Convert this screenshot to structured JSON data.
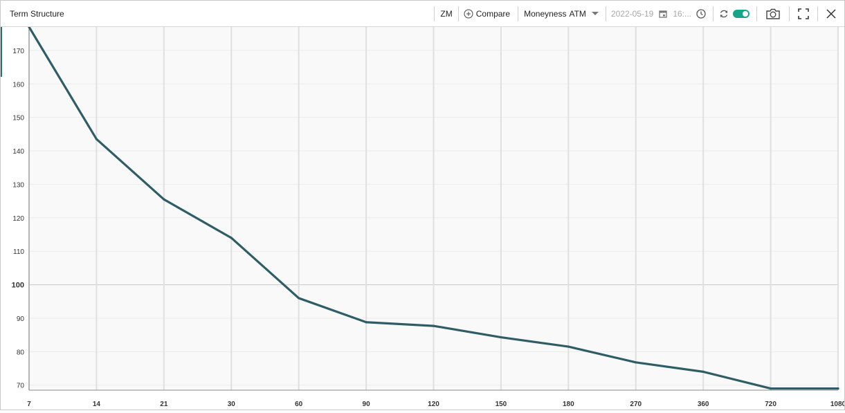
{
  "header": {
    "title": "Term Structure",
    "ticker": "ZM",
    "compare_label": "Compare",
    "moneyness_label": "Moneyness",
    "moneyness_value": "ATM",
    "date": "2022-05-19",
    "time": "16:..."
  },
  "colors": {
    "line": "#2f5d66",
    "toggle": "#17a589",
    "plot_bg": "#f9f9f9"
  },
  "chart_data": {
    "type": "line",
    "categories": [
      "7",
      "14",
      "21",
      "30",
      "60",
      "90",
      "120",
      "150",
      "180",
      "270",
      "360",
      "720",
      "1080"
    ],
    "values": [
      177.0,
      143.5,
      125.5,
      114.0,
      96.0,
      88.8,
      87.7,
      84.3,
      81.5,
      76.8,
      74.0,
      69.0,
      69.0
    ],
    "yticks": [
      70,
      80,
      90,
      100,
      110,
      120,
      130,
      140,
      150,
      160,
      170
    ],
    "ylim": [
      68.5,
      177
    ],
    "grid": true
  }
}
